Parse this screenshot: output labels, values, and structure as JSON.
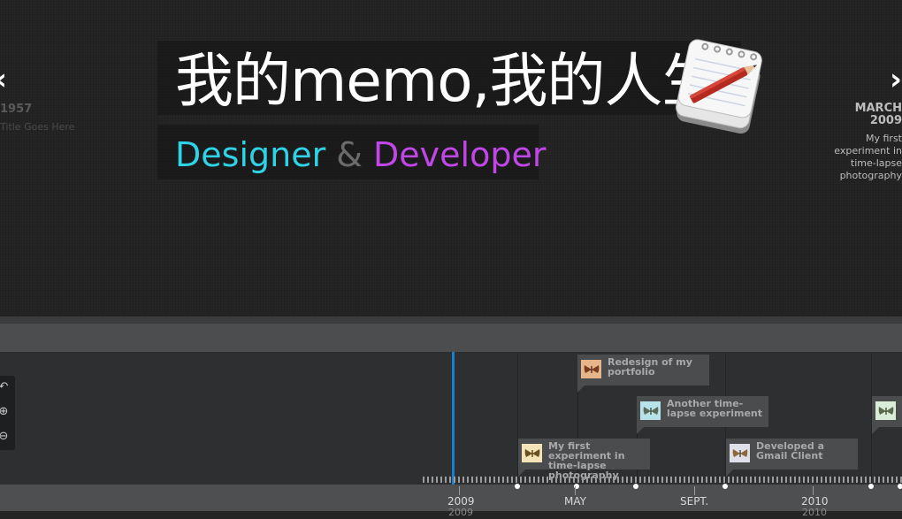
{
  "header": {
    "title": "我的memo,我的人生",
    "subtitle": {
      "designer": "Designer",
      "amp": "&",
      "developer": "Developer"
    },
    "colors": {
      "designer": "#2fd3e8",
      "developer": "#c046e8",
      "accent": "#1582d0"
    }
  },
  "nav": {
    "prev": {
      "arrow": "‹",
      "date": "1957",
      "title": "Title Goes Here"
    },
    "next": {
      "arrow": "›",
      "date": "MARCH 2009",
      "title": "My first experiment in time-lapse photography"
    }
  },
  "tools": [
    {
      "icon": "back-icon",
      "glyph": "↶"
    },
    {
      "icon": "zoom-in-icon",
      "glyph": "⊕"
    },
    {
      "icon": "zoom-out-icon",
      "glyph": "⊖"
    }
  ],
  "events": [
    {
      "label": "Redesign of my portfolio",
      "thumb_bg": "#e6b58a",
      "icon": "butterfly-icon"
    },
    {
      "label": "Another time-lapse experiment",
      "thumb_bg": "#b7e2e8",
      "icon": "butterfly-icon"
    },
    {
      "label": "My first experiment in time-lapse photography",
      "thumb_bg": "#f3e3b8",
      "icon": "butterfly-icon"
    },
    {
      "label": "Developed a Gmail Client",
      "thumb_bg": "#e0e0ea",
      "icon": "butterfly-icon"
    },
    {
      "label": "",
      "thumb_bg": "#d9ecd8",
      "icon": "butterfly-icon"
    }
  ],
  "axis": {
    "labels": [
      "2009",
      "MAY",
      "SEPT.",
      "2010"
    ],
    "sublabels": [
      "2009",
      "2010"
    ]
  }
}
